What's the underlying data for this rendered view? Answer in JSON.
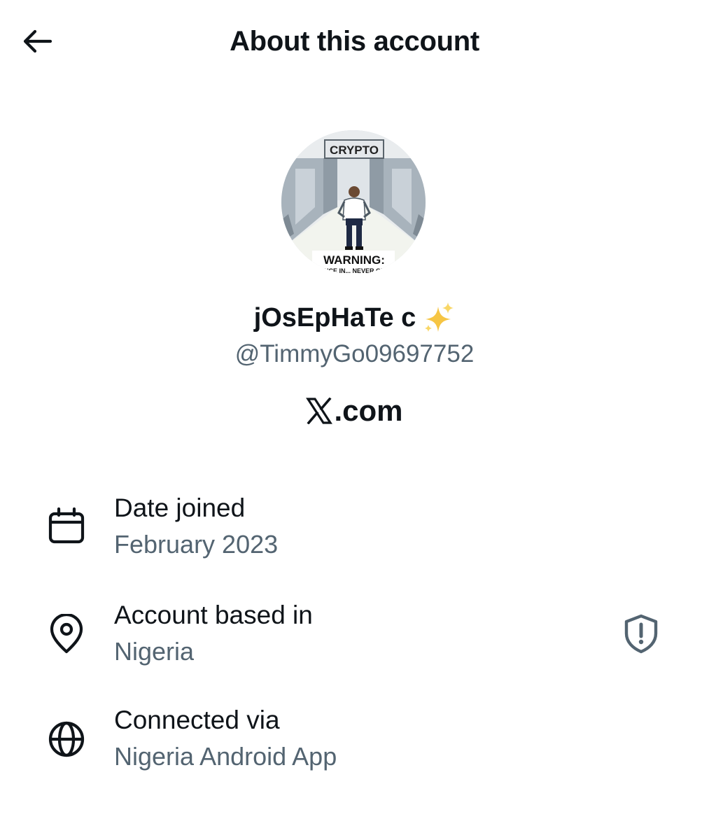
{
  "header": {
    "title": "About this account",
    "back_icon": "arrow-left-icon"
  },
  "profile": {
    "avatar_texts": {
      "top_sign": "CRYPTO",
      "bottom_sign": "WARNING:",
      "bottom_sub": "ONCE IN... NEVER OUT"
    },
    "display_name": "jOsEpHaTe c",
    "name_emoji": "sparkles-icon",
    "handle": "@TimmyGo09697752",
    "site": ".com",
    "site_logo": "x-logo-icon"
  },
  "details": [
    {
      "icon": "calendar-icon",
      "label": "Date joined",
      "value": "February 2023"
    },
    {
      "icon": "location-pin-icon",
      "label": "Account based in",
      "value": "Nigeria",
      "action_icon": "shield-alert-icon"
    },
    {
      "icon": "globe-icon",
      "label": "Connected via",
      "value": "Nigeria Android App"
    }
  ],
  "colors": {
    "text_primary": "#0f1419",
    "text_secondary": "#536471",
    "background": "#ffffff"
  }
}
